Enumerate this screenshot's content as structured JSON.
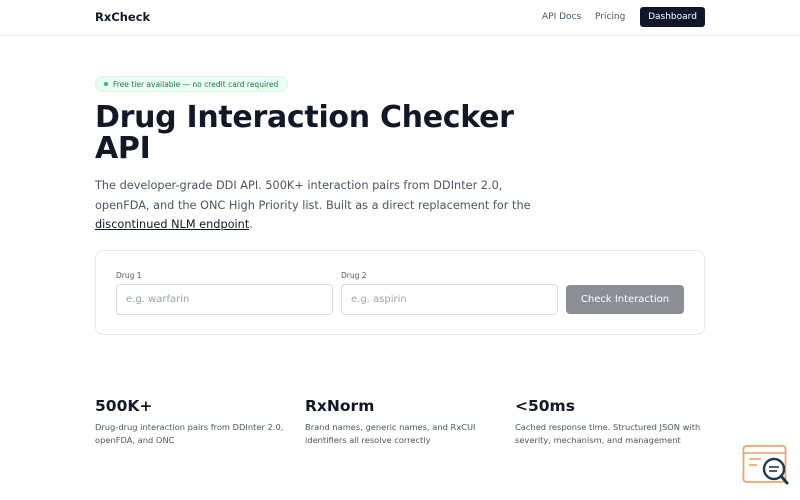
{
  "nav": {
    "brand": "RxCheck",
    "links": [
      "API Docs",
      "Pricing"
    ],
    "dashboard": "Dashboard"
  },
  "hero": {
    "badge": "Free tier available — no credit card required",
    "title": "Drug Interaction Checker API",
    "subtitle": "The developer-grade DDI API. 500K+ interaction pairs from DDInter 2.0, openFDA, and the ONC High Priority list. Built as a direct replacement for the",
    "subtitle_link": "discontinued NLM endpoint",
    "subtitle_end": "."
  },
  "checker": {
    "drug1_label": "Drug 1",
    "drug1_placeholder": "e.g. warfarin",
    "drug2_label": "Drug 2",
    "drug2_placeholder": "e.g. aspirin",
    "button": "Check Interaction"
  },
  "stats": [
    {
      "value": "500K+",
      "desc": "Drug-drug interaction pairs from DDInter 2.0, openFDA, and ONC"
    },
    {
      "value": "RxNorm",
      "desc": "Brand names, generic names, and RxCUI identifiers all resolve correctly"
    },
    {
      "value": "<50ms",
      "desc": "Cached response time. Structured JSON with severity, mechanism, and management"
    }
  ],
  "colors": {
    "primary": "#0f172a",
    "badge_bg": "#ecfdf3",
    "badge_text": "#15803d",
    "button_disabled": "#8b8e94",
    "widget_accent": "#f0a266"
  },
  "icons": {
    "badge": "status-dot-icon",
    "widget": "chat-search-icon"
  }
}
